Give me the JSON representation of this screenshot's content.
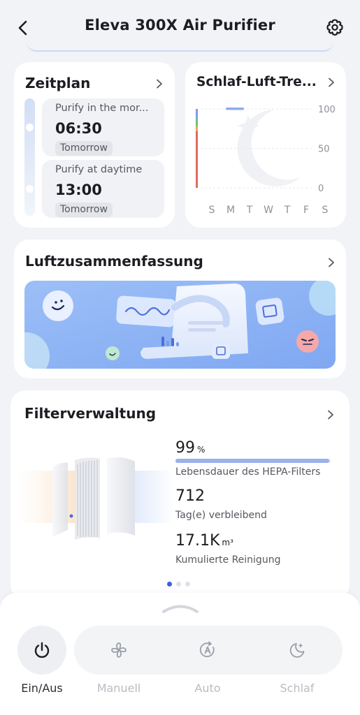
{
  "header": {
    "title": "Eleva 300X Air Purifier",
    "back_icon": "arrow-left-icon",
    "settings_icon": "gear-icon"
  },
  "schedule": {
    "title": "Zeitplan",
    "items": [
      {
        "name": "Purify in the mor...",
        "time": "06:30",
        "day": "Tomorrow"
      },
      {
        "name": "Purify at daytime",
        "time": "13:00",
        "day": "Tomorrow"
      }
    ]
  },
  "sleep_trend": {
    "title": "Schlaf-Luft-Tre...",
    "chart_data": {
      "type": "bar",
      "categories": [
        "S",
        "M",
        "T",
        "W",
        "T",
        "F",
        "S"
      ],
      "yticks": [
        100,
        50,
        0
      ],
      "ylim": [
        0,
        100
      ],
      "title": "",
      "xlabel": "",
      "ylabel": "",
      "series": [
        {
          "values": [
            null,
            100,
            null,
            null,
            null,
            null,
            null
          ]
        }
      ],
      "scale_colors": [
        "#e06a5f",
        "#e9a65a",
        "#6cc07c",
        "#7d9de6"
      ]
    }
  },
  "summary": {
    "title": "Luftzusammenfassung"
  },
  "filter": {
    "title": "Filterverwaltung",
    "life_value": "99",
    "life_unit": "%",
    "life_fraction": 0.99,
    "life_label": "Lebensdauer des HEPA-Filters",
    "days_value": "712",
    "days_label": "Tag(e) verbleibend",
    "cumulative_value": "17.1K",
    "cumulative_unit": "m³",
    "cumulative_label": "Kumulierte Reinigung",
    "page_index": 0,
    "page_count": 3
  },
  "controls": {
    "power_label": "Ein/Aus",
    "modes": [
      {
        "label": "Manuell",
        "icon": "fan-icon"
      },
      {
        "label": "Auto",
        "icon": "auto-mode-icon"
      },
      {
        "label": "Schlaf",
        "icon": "sleep-moon-icon"
      }
    ]
  },
  "colors": {
    "accent": "#3d5ee0",
    "banner_bg": "#8db2f5",
    "muted": "#b9bcc3"
  }
}
